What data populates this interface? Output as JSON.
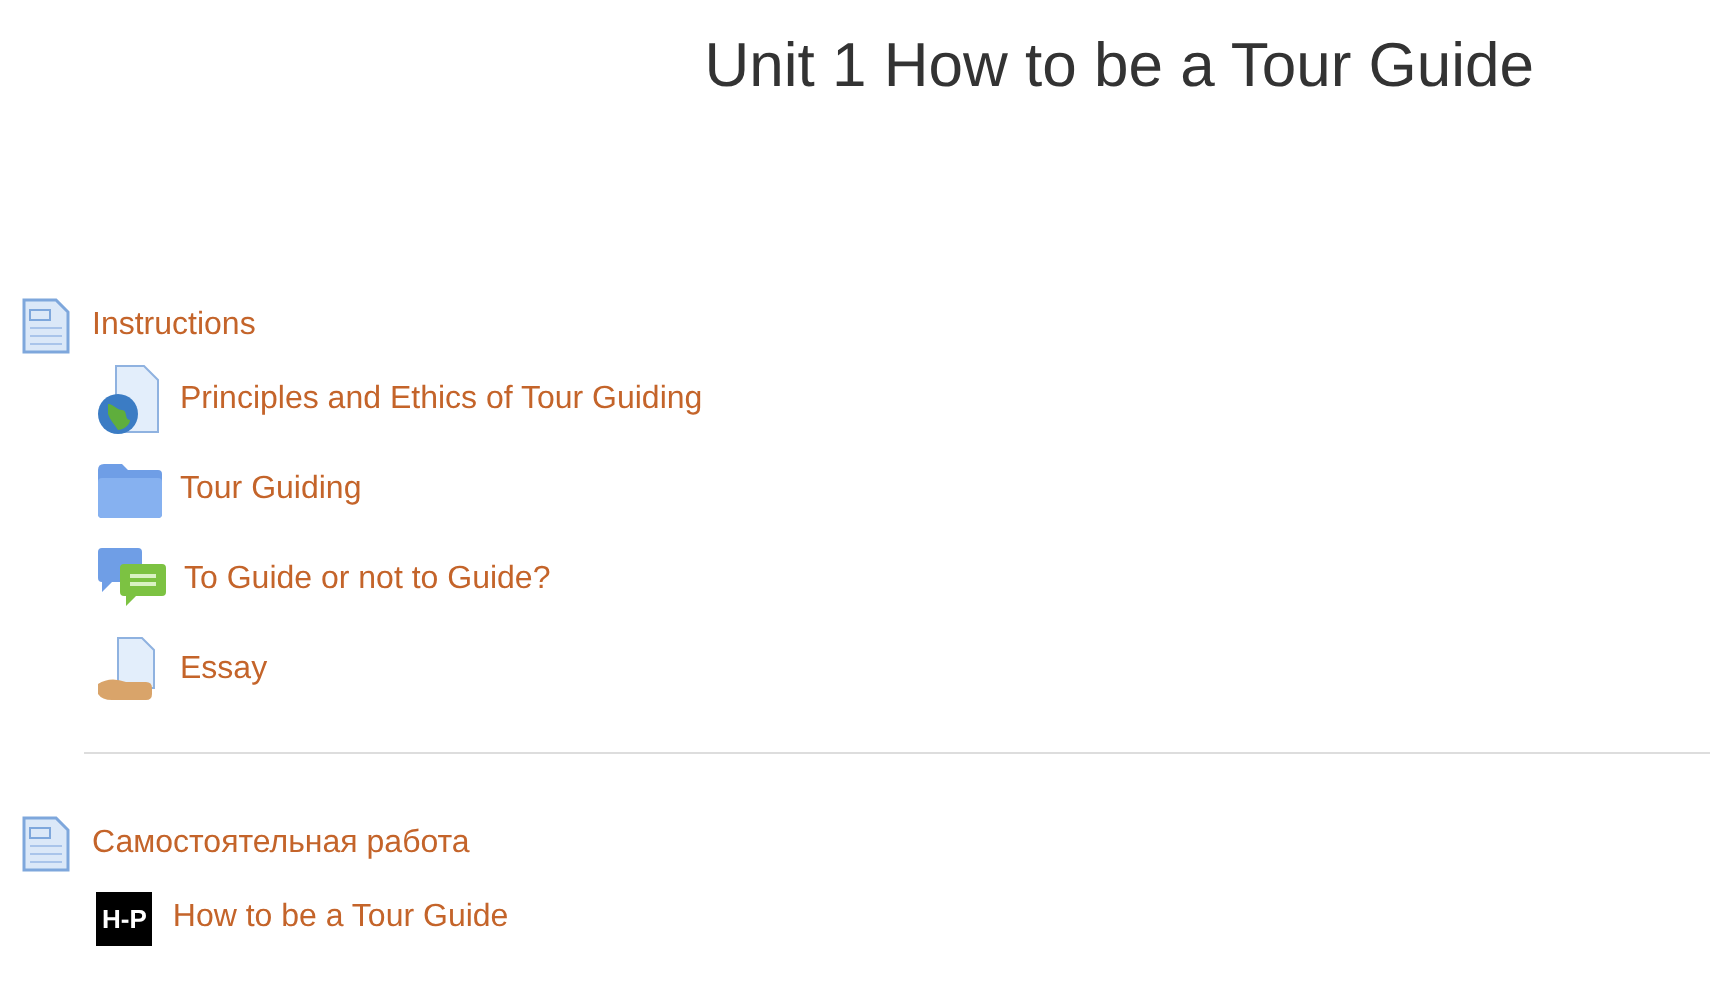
{
  "title": "Unit 1 How to be a Tour Guide",
  "sections": [
    {
      "label": "Instructions",
      "kind": "page",
      "children": [
        {
          "label": "Principles and Ethics of Tour Guiding",
          "kind": "url"
        },
        {
          "label": "Tour Guiding",
          "kind": "folder"
        },
        {
          "label": "To Guide or not to Guide?",
          "kind": "forum"
        },
        {
          "label": "Essay",
          "kind": "assignment"
        }
      ]
    },
    {
      "label": "Самостоятельная работа",
      "kind": "page",
      "children": [
        {
          "label": "How to be a Tour Guide",
          "kind": "hvp",
          "badge": "H-P"
        }
      ]
    }
  ]
}
